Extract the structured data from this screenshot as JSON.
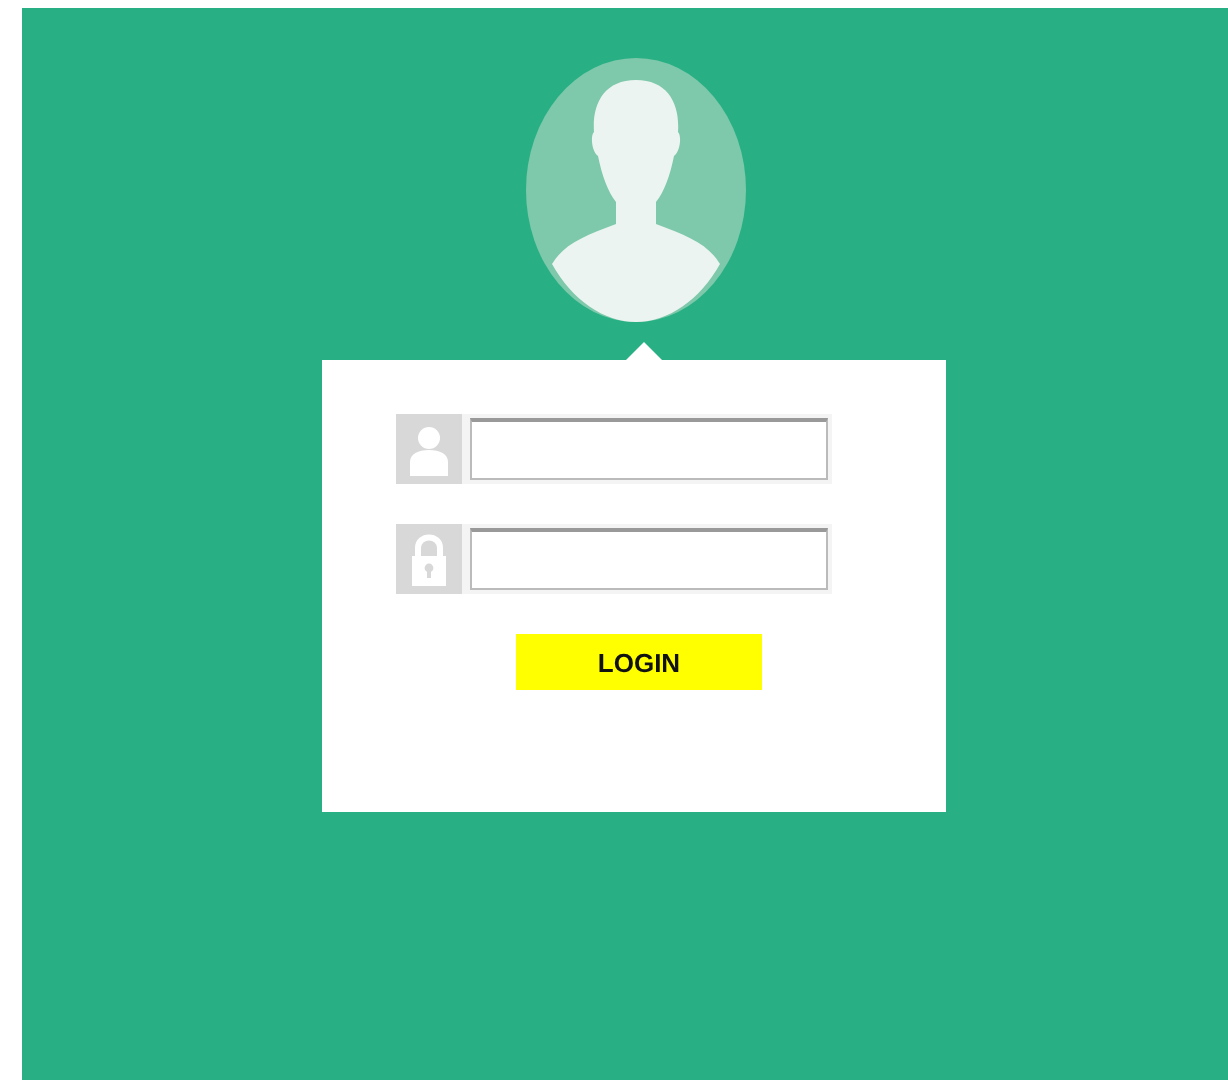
{
  "login_form": {
    "fields": [
      {
        "kind": "user"
      },
      {
        "kind": "password"
      }
    ],
    "button": {
      "label": "LOGIN"
    }
  }
}
